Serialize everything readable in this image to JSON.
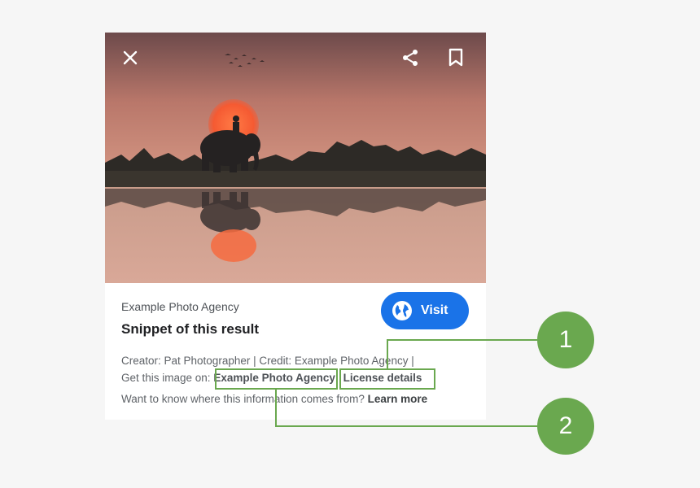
{
  "card": {
    "source_name": "Example Photo Agency",
    "title": "Snippet of this result",
    "visit_label": "Visit",
    "creator_line": "Creator: Pat Photographer | Credit: Example Photo Agency |",
    "get_image_prefix": "Get this image on:",
    "get_image_link": "Example Photo Agency",
    "license_link": "License details",
    "info_question": "Want to know where this information comes from?",
    "learn_more": "Learn more"
  },
  "callouts": [
    {
      "number": "1",
      "target": "License details"
    },
    {
      "number": "2",
      "target": "Example Photo Agency"
    }
  ],
  "icons": {
    "close": "close-icon",
    "share": "share-icon",
    "bookmark": "bookmark-icon",
    "globe": "globe-icon"
  },
  "colors": {
    "visit_button": "#1a73e8",
    "callout_green": "#6aa84f"
  }
}
